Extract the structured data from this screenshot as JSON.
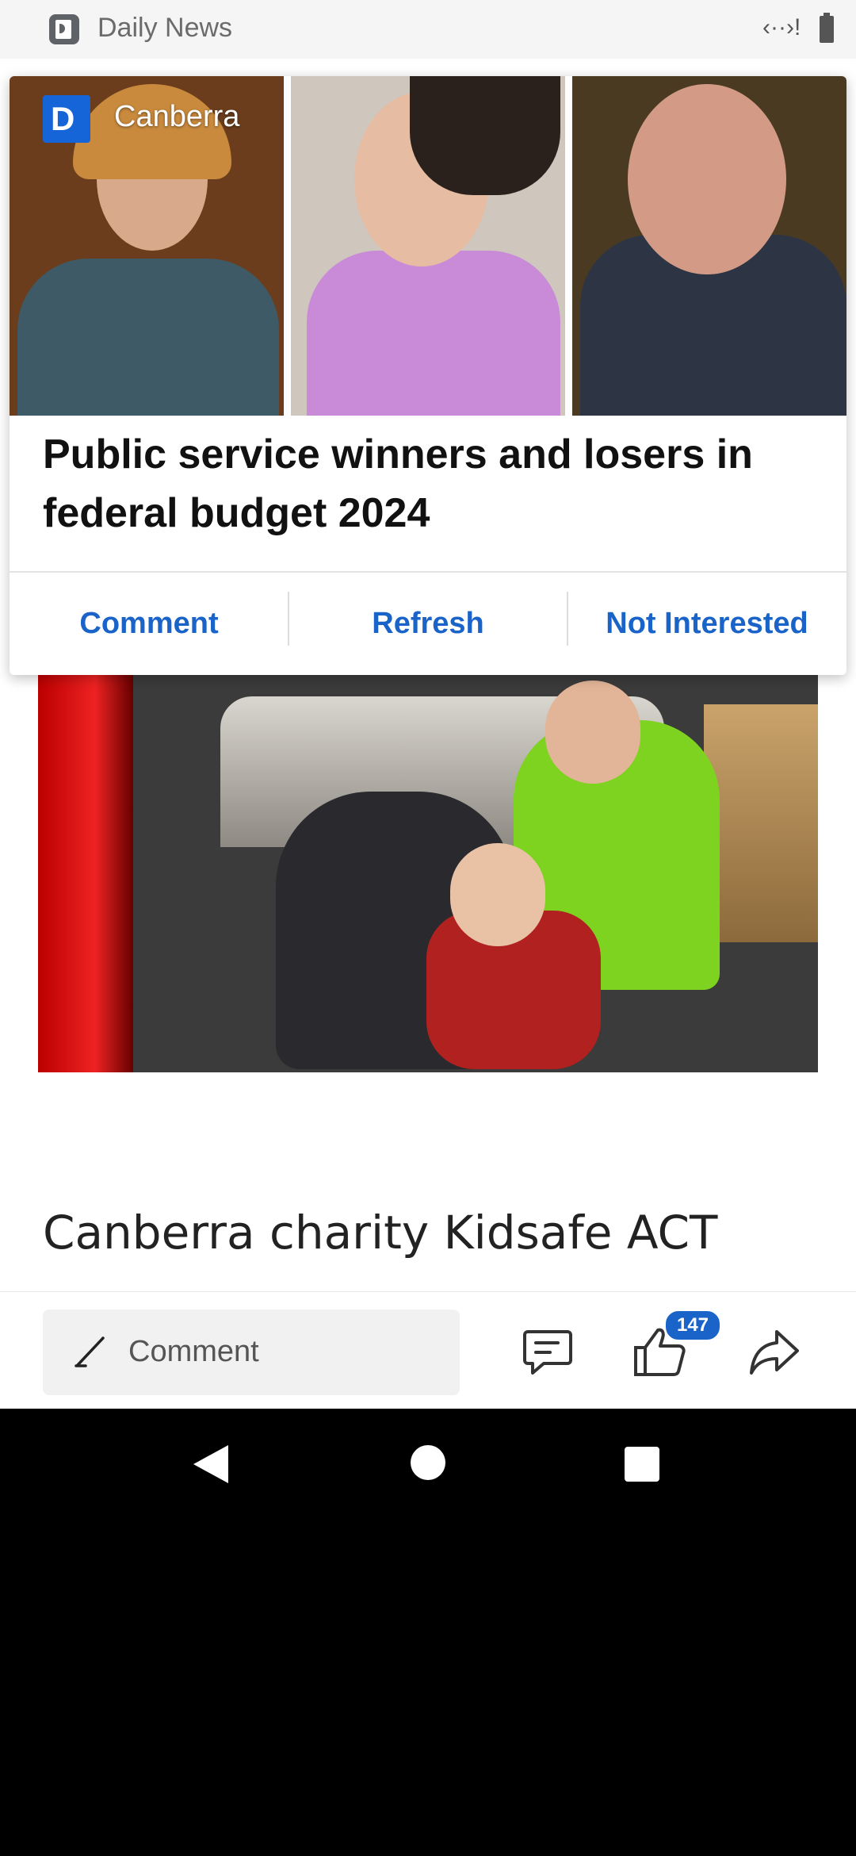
{
  "status_bar": {
    "app_title": "Daily News",
    "icons": [
      "daily-news-app-icon",
      "cast-icon",
      "battery-icon"
    ]
  },
  "overlay_card": {
    "source_name": "Canberra",
    "source_logo_letter": "D",
    "headline": "Public service winners and losers in federal budget 2024",
    "actions": {
      "comment": "Comment",
      "refresh": "Refresh",
      "not_interested": "Not Interested"
    }
  },
  "article": {
    "headline_partial": "Canberra charity Kidsafe ACT"
  },
  "bottom_bar": {
    "comment_placeholder": "Comment",
    "like_count": "147",
    "icons": [
      "pencil-icon",
      "comments-icon",
      "thumbs-up-icon",
      "share-icon"
    ]
  },
  "nav_bar": {
    "icons": [
      "back-icon",
      "home-icon",
      "recents-icon"
    ]
  },
  "colors": {
    "accent": "#1a63c8",
    "logo_blue": "#1565d8"
  }
}
